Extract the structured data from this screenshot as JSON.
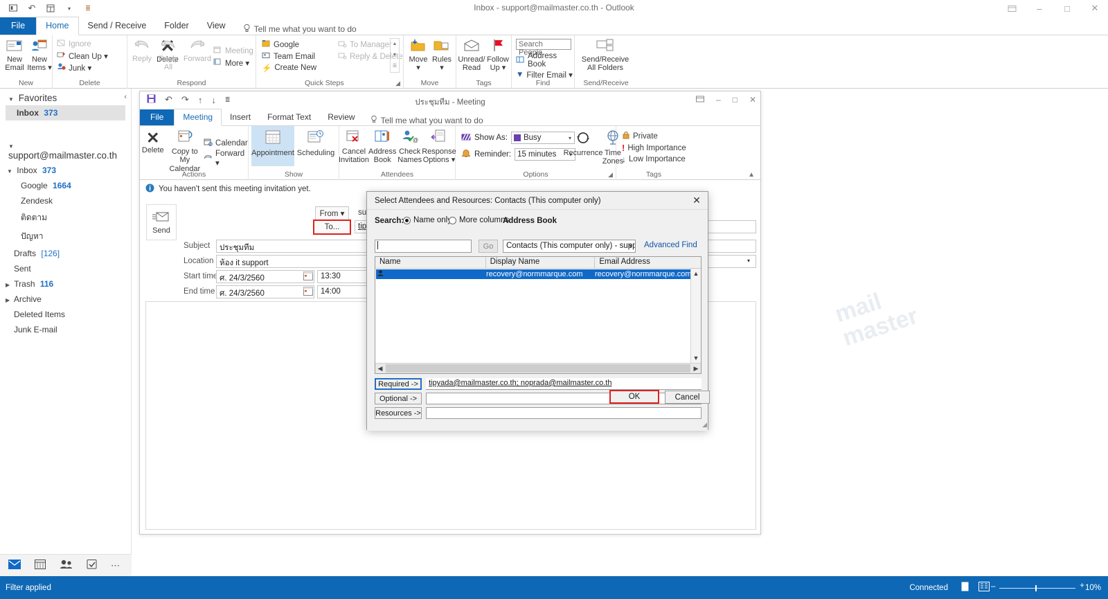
{
  "app": {
    "title": "Inbox - support@mailmaster.co.th - Outlook",
    "qat": [
      "touch-mode-icon",
      "undo-icon",
      "send-receive-icon",
      "chevron-down-icon",
      "customize-qat-icon"
    ],
    "window_controls": [
      "ribbon-display-options-icon",
      "minimize-icon",
      "maximize-icon",
      "close-icon"
    ]
  },
  "ribbon": {
    "tabs": [
      {
        "label": "File",
        "active": false
      },
      {
        "label": "Home",
        "active": true
      },
      {
        "label": "Send / Receive",
        "active": false
      },
      {
        "label": "Folder",
        "active": false
      },
      {
        "label": "View",
        "active": false
      }
    ],
    "tellme": "Tell me what you want to do",
    "groups": [
      {
        "name": "New",
        "label": "New",
        "buttons": [
          {
            "label": "New\nEmail",
            "icon": "new-email-icon"
          },
          {
            "label": "New\nItems ▾",
            "icon": "new-items-icon"
          }
        ]
      },
      {
        "name": "Delete",
        "label": "Delete",
        "small": [
          {
            "label": "Ignore",
            "icon": "ignore-icon",
            "dim": true
          },
          {
            "label": "Clean Up ▾",
            "icon": "cleanup-icon",
            "dim": false
          },
          {
            "label": "Junk ▾",
            "icon": "junk-icon",
            "dim": false
          }
        ],
        "buttons": [
          {
            "label": "Delete",
            "icon": "delete-x-icon"
          }
        ]
      },
      {
        "name": "Respond",
        "label": "Respond",
        "buttons": [
          {
            "label": "Reply",
            "icon": "reply-icon"
          },
          {
            "label": "Reply\nAll",
            "icon": "reply-all-icon"
          },
          {
            "label": "Forward",
            "icon": "forward-icon"
          }
        ],
        "small": [
          {
            "label": "Meeting",
            "icon": "meeting-icon",
            "dim": false
          },
          {
            "label": "More ▾",
            "icon": "more-icon",
            "dim": false
          }
        ]
      },
      {
        "name": "Quick Steps",
        "label": "Quick Steps",
        "small": [
          {
            "label": "Google",
            "icon": "quickstep-google-icon",
            "dim": false
          },
          {
            "label": "Team Email",
            "icon": "quickstep-team-email-icon",
            "dim": false
          },
          {
            "label": "Create New",
            "icon": "quickstep-create-new-icon",
            "dim": false
          },
          {
            "label": "To Manager",
            "icon": "quickstep-to-manager-icon",
            "dim": true
          },
          {
            "label": "Reply & Delete",
            "icon": "quickstep-reply-delete-icon",
            "dim": true
          }
        ]
      },
      {
        "name": "Move",
        "label": "Move",
        "buttons": [
          {
            "label": "Move\n▾",
            "icon": "move-folder-icon"
          },
          {
            "label": "Rules\n▾",
            "icon": "rules-icon"
          }
        ]
      },
      {
        "name": "Tags",
        "label": "Tags",
        "buttons": [
          {
            "label": "Unread/\nRead",
            "icon": "unread-read-icon"
          },
          {
            "label": "Follow\nUp ▾",
            "icon": "follow-up-flag-icon"
          }
        ]
      },
      {
        "name": "Find",
        "label": "Find",
        "small": [
          {
            "label": "Search People",
            "icon": "search-people-box",
            "dim": false
          },
          {
            "label": "Address Book",
            "icon": "address-book-icon",
            "dim": false
          },
          {
            "label": "Filter Email ▾",
            "icon": "filter-email-icon",
            "dim": false
          }
        ]
      },
      {
        "name": "Send/Receive",
        "label": "Send/Receive",
        "buttons": [
          {
            "label": "Send/Receive\nAll Folders",
            "icon": "send-receive-all-icon"
          }
        ]
      }
    ]
  },
  "sidebar": {
    "favorites_header": "Favorites",
    "favorites": [
      {
        "label": "Inbox",
        "count": "373",
        "selected": true
      }
    ],
    "account": "support@mailmaster.co.th",
    "folders": [
      {
        "label": "Inbox",
        "count": "373",
        "indent": 1,
        "expander": "expanded"
      },
      {
        "label": "Google",
        "count": "1664",
        "indent": 2,
        "expander": "none"
      },
      {
        "label": "Zendesk",
        "count": "",
        "indent": 2,
        "expander": "none"
      },
      {
        "label": "ติดตาม",
        "count": "",
        "indent": 2,
        "expander": "none"
      },
      {
        "label": "ปัญหา",
        "count": "",
        "indent": 2,
        "expander": "none"
      },
      {
        "label": "Drafts",
        "count": "[126]",
        "indent": 1,
        "expander": "none"
      },
      {
        "label": "Sent",
        "count": "",
        "indent": 1,
        "expander": "none"
      },
      {
        "label": "Trash",
        "count": "116",
        "indent": 1,
        "expander": "collapsed"
      },
      {
        "label": "Archive",
        "count": "",
        "indent": 1,
        "expander": "collapsed"
      },
      {
        "label": "Deleted Items",
        "count": "",
        "indent": 1,
        "expander": "none"
      },
      {
        "label": "Junk E-mail",
        "count": "",
        "indent": 1,
        "expander": "none"
      }
    ],
    "nav_bottom": [
      "mail-icon",
      "calendar-icon",
      "people-icon",
      "tasks-icon",
      "more-options-icon"
    ]
  },
  "statusbar": {
    "left": "Filter applied",
    "connected": "Connected",
    "views": [
      "normal-view-icon",
      "reading-view-icon"
    ],
    "zoom": "10%"
  },
  "meeting_window": {
    "title": "ประชุมทีม - Meeting",
    "qat": [
      "save-icon",
      "undo-icon",
      "redo-icon",
      "previous-item-icon",
      "next-item-icon",
      "customize-qat-icon"
    ],
    "window_controls": [
      "ribbon-display-options-icon",
      "minimize-icon",
      "maximize-icon",
      "close-icon"
    ],
    "tabs": [
      {
        "label": "File",
        "active": false
      },
      {
        "label": "Meeting",
        "active": true
      },
      {
        "label": "Insert",
        "active": false
      },
      {
        "label": "Format Text",
        "active": false
      },
      {
        "label": "Review",
        "active": false
      }
    ],
    "tellme": "Tell me what you want to do",
    "groups": [
      {
        "name": "Actions",
        "label": "Actions",
        "buttons": [
          {
            "label": "Delete",
            "icon": "delete-x-icon"
          },
          {
            "label": "Copy to My\nCalendar",
            "icon": "copy-to-calendar-icon"
          }
        ],
        "small": [
          {
            "label": "Calendar",
            "icon": "calendar-preview-icon"
          },
          {
            "label": "Forward  ▾",
            "icon": "forward-icon"
          }
        ]
      },
      {
        "name": "Show",
        "label": "Show",
        "buttons": [
          {
            "label": "Appointment",
            "icon": "appointment-icon",
            "selected": true
          },
          {
            "label": "Scheduling",
            "icon": "scheduling-icon",
            "selected": false
          }
        ]
      },
      {
        "name": "Attendees",
        "label": "Attendees",
        "buttons": [
          {
            "label": "Cancel\nInvitation",
            "icon": "cancel-invitation-icon"
          },
          {
            "label": "Address\nBook",
            "icon": "address-book-icon"
          },
          {
            "label": "Check\nNames",
            "icon": "check-names-icon"
          },
          {
            "label": "Response\nOptions ▾",
            "icon": "response-options-icon"
          }
        ]
      },
      {
        "name": "Options",
        "label": "Options",
        "fields": [
          {
            "label": "Show As:",
            "value": "Busy",
            "icon": "show-as-icon"
          },
          {
            "label": "Reminder:",
            "value": "15 minutes",
            "icon": "reminder-bell-icon"
          }
        ],
        "buttons": [
          {
            "label": "Recurrence",
            "icon": "recurrence-icon"
          },
          {
            "label": "Time\nZones",
            "icon": "time-zones-globe-icon"
          }
        ]
      },
      {
        "name": "Tags",
        "label": "Tags",
        "small": [
          {
            "label": "Private",
            "icon": "private-lock-icon"
          },
          {
            "label": "High Importance",
            "icon": "high-importance-icon"
          },
          {
            "label": "Low Importance",
            "icon": "low-importance-icon"
          }
        ]
      }
    ],
    "infobar": "You haven't sent this meeting invitation yet.",
    "send_label": "Send",
    "from_label": "From ▾",
    "from_value": "support@mailmaster.co.th",
    "to_label": "To...",
    "to_value": "tipyada@mailmaster.co.th; noprada@mailmaster.co.th",
    "fields": [
      {
        "label": "Subject",
        "value": "ประชุมทีม"
      },
      {
        "label": "Location",
        "value": "ห้อง it support"
      },
      {
        "label": "Start time",
        "value": "ศ. 24/3/2560",
        "time": "13:30"
      },
      {
        "label": "End time",
        "value": "ศ. 24/3/2560",
        "time": "14:00"
      }
    ]
  },
  "dialog": {
    "title": "Select Attendees and Resources: Contacts (This computer only)",
    "search_label": "Search:",
    "radios": [
      {
        "label": "Name only",
        "checked": true
      },
      {
        "label": "More columns",
        "checked": false
      }
    ],
    "address_book_label": "Address Book",
    "search_value": "",
    "go_label": "Go",
    "address_book_value": "Contacts (This computer only) - support@n",
    "advanced_find": "Advanced Find",
    "columns": [
      "Name",
      "Display Name",
      "Email Address"
    ],
    "rows": [
      {
        "name": "",
        "display_name": "recovery@normmarque.com",
        "email": "recovery@normmarque.com",
        "selected": true
      }
    ],
    "picker_rows": [
      {
        "button": "Required ->",
        "value": "tipyada@mailmaster.co.th; noprada@mailmaster.co.th",
        "focused": true
      },
      {
        "button": "Optional ->",
        "value": "",
        "focused": false
      },
      {
        "button": "Resources ->",
        "value": "",
        "focused": false
      }
    ],
    "ok_label": "OK",
    "cancel_label": "Cancel",
    "accent_red": "#e02020",
    "selection_blue": "#1069c8"
  }
}
